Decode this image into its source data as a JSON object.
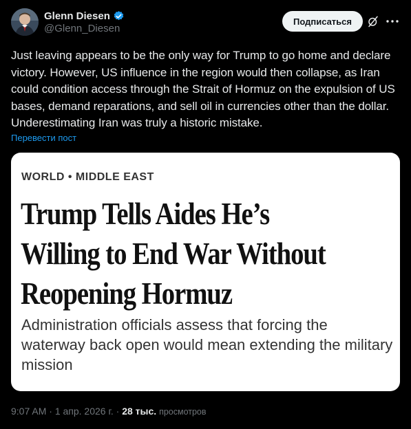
{
  "author": {
    "name": "Glenn Diesen",
    "handle": "@Glenn_Diesen"
  },
  "actions": {
    "subscribe_label": "Подписаться"
  },
  "tweet": {
    "text": "Just leaving appears to be the only way for Trump to go home and declare victory. However, US influence in the region would then collapse, as Iran could condition access through the Strait of Hormuz on the expulsion of US bases, demand reparations, and sell oil in currencies other than the dollar. Underestimating Iran was truly a historic mistake.",
    "translate_label": "Перевести пост"
  },
  "card": {
    "section": "WORLD • MIDDLE EAST",
    "headline_lines": [
      "Trump Tells Aides He’s",
      "Willing to End War Without",
      "Reopening Hormuz"
    ],
    "deck": "Administration officials assess that forcing the waterway back open would mean extending the military mission"
  },
  "footer": {
    "time": "9:07 AM",
    "date": "1 апр. 2026 г.",
    "views_count": "28 тыс.",
    "views_label": "просмотров"
  },
  "colors": {
    "background": "#000000",
    "text": "#e7e9ea",
    "muted": "#71767b",
    "link": "#1d9bf0",
    "verified": "#1d9bf0",
    "button_bg": "#eff3f4"
  },
  "icons": {
    "verified": "verified-badge-icon",
    "grok": "grok-icon",
    "more": "more-horizontal-icon"
  }
}
